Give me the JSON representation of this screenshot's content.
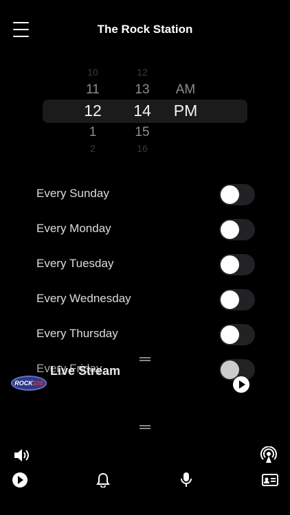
{
  "header": {
    "title": "The Rock Station",
    "menu_icon": "hamburger-menu-icon"
  },
  "time_picker": {
    "hours": {
      "far_above": "10",
      "near_above": "11",
      "selected": "12",
      "near_below": "1",
      "far_below": "2"
    },
    "minutes": {
      "far_above": "12",
      "near_above": "13",
      "selected": "14",
      "near_below": "15",
      "far_below": "16"
    },
    "period": {
      "near_above": "AM",
      "selected": "PM"
    }
  },
  "alarms": [
    {
      "label": "Every Sunday",
      "enabled": false
    },
    {
      "label": "Every Monday",
      "enabled": false
    },
    {
      "label": "Every Tuesday",
      "enabled": false
    },
    {
      "label": "Every Wednesday",
      "enabled": false
    },
    {
      "label": "Every Thursday",
      "enabled": false
    },
    {
      "label": "Every Friday",
      "enabled": false
    }
  ],
  "player": {
    "station_logo_text": "ROCK",
    "station_logo_accent": "108",
    "now_playing": "Live Stream",
    "play_icon": "play-icon"
  },
  "bottom_bar": {
    "volume_icon": "speaker-volume-icon",
    "airplay_icon": "airplay-broadcast-icon",
    "tabs": [
      {
        "name": "play-icon"
      },
      {
        "name": "bell-icon"
      },
      {
        "name": "microphone-icon"
      },
      {
        "name": "contact-card-icon"
      }
    ]
  },
  "colors": {
    "background": "#000000",
    "toggle_off_track": "#222225",
    "picker_band": "#1b1b1c",
    "logo_blue": "#2d3a8c",
    "logo_red": "#e0322b"
  }
}
